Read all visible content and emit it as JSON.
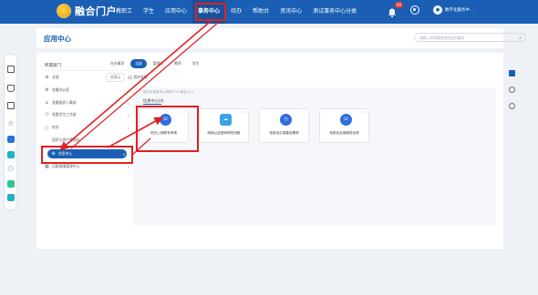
{
  "header": {
    "brand": "融合门户",
    "nav": [
      "教职工",
      "学生",
      "应用中心",
      "事务中心",
      "待办",
      "帮助台",
      "资讯中心",
      "测试事务中心分类"
    ],
    "active_nav": "事务中心",
    "badge": "99",
    "user": "数字化服务中..."
  },
  "page": {
    "title": "应用中心",
    "search_placeholder": "请输入你需要查找的应用服务"
  },
  "left": {
    "title": "所属部门",
    "items": [
      {
        "label": "全部",
        "count": "0"
      },
      {
        "label": "党委办公室",
        "count": "1"
      },
      {
        "label": "党委组织人事部",
        "count": "1"
      },
      {
        "label": "党委学生工作部",
        "count": "1"
      },
      {
        "label": "校办",
        "count": "1"
      },
      {
        "label": "国资与资产管理处",
        "count": ""
      },
      {
        "label": "信息中心",
        "count": "4"
      },
      {
        "label": "后勤保障管理中心",
        "count": "1"
      }
    ]
  },
  "tabs": [
    "在办事项",
    "全部",
    "管理员",
    "教师",
    "学生"
  ],
  "active_tab": "全部",
  "subtabs": [
    "仅显示",
    "我的收藏"
  ],
  "hint": "您已为信息中心申请了4个事务入口",
  "group": "信息中心(4)",
  "cards": [
    {
      "label": "校外上网账号申请"
    },
    {
      "label": "网络认证密码修改流程"
    },
    {
      "label": "信息化应用建设需求"
    },
    {
      "label": "信息化应用服务反馈"
    }
  ]
}
